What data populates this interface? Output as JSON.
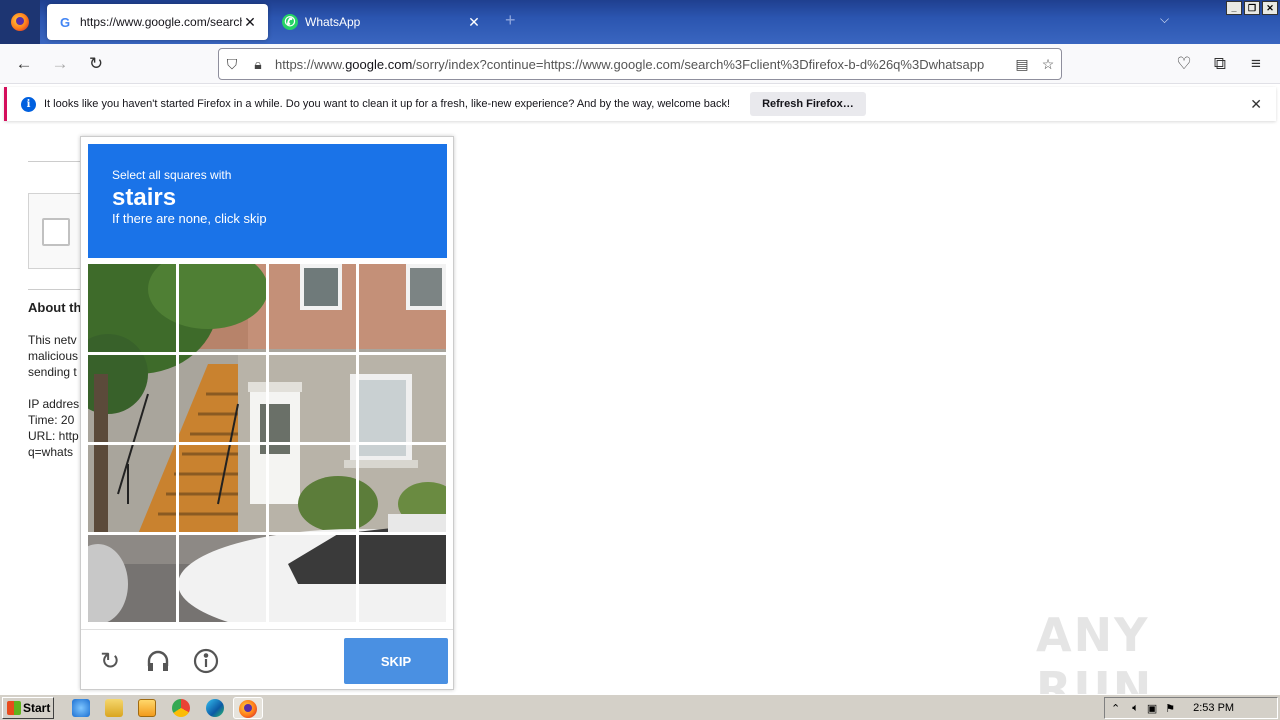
{
  "browser": {
    "tabs": [
      {
        "title": "https://www.google.com/search?c",
        "icon": "google-favicon"
      },
      {
        "title": "WhatsApp",
        "icon": "whatsapp-favicon"
      }
    ],
    "url_prefix": "https://www.",
    "url_domain": "google.com",
    "url_rest": "/sorry/index?continue=https://www.google.com/search%3Fclient%3Dfirefox-b-d%26q%3Dwhatsapp"
  },
  "notification": {
    "message": "It looks like you haven't started Firefox in a while. Do you want to clean it up for a fresh, like-new experience? And by the way, welcome back!",
    "button": "Refresh Firefox…"
  },
  "page": {
    "heading": "About th",
    "lines1": [
      "This netv",
      "malicious",
      "sending t"
    ],
    "lines2": [
      "IP addres",
      "Time: 20",
      "URL: http",
      "q=whats"
    ]
  },
  "captcha": {
    "line1": "Select all squares with",
    "keyword": "stairs",
    "line3": "If there are none, click skip",
    "skip_label": "SKIP",
    "accent": "#1a73e8"
  },
  "watermark": "ANY RUN",
  "taskbar": {
    "start_label": "Start",
    "time": "2:53 PM"
  }
}
